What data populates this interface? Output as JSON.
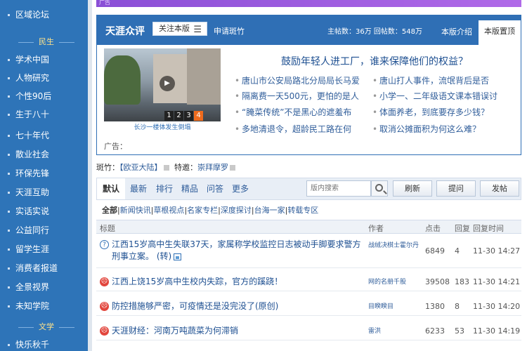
{
  "sidebar": {
    "top_item": "区域论坛",
    "section_minsheng": "民生",
    "minsheng_items": [
      "学术中国",
      "人物研究",
      "个性90后",
      "生于八十",
      "七十年代",
      "散业社会",
      "环保先锋",
      "天涯互助",
      "实话实说",
      "公益同行",
      "留学生涯",
      "消费者报道",
      "全景视界",
      "未知学院"
    ],
    "section_wenxue": "文学",
    "wenxue_items": [
      "快乐秋千"
    ]
  },
  "banner": {
    "ad_label": "广告"
  },
  "feature": {
    "logo": "天涯众评",
    "follow_label": "关注本版",
    "follow_icon": "menu-icon",
    "apply_label": "申请斑竹",
    "stats": "主帖数：36万  回帖数：548万",
    "tab_intro": "本版介绍",
    "tab_top": "本版置顶",
    "photo_caption": "长沙一楼体发生倒塌",
    "pager": [
      "1",
      "2",
      "3",
      "4"
    ],
    "headline": "鼓励年轻人进工厂，谁来保障他们的权益？",
    "news_left": [
      "唐山市公安局路北分局局长马爱",
      "隔离费一天500元，更怕的是人",
      "“腌菜传统”不是黑心的遮羞布",
      "多地清退令，超龄民工路在何"
    ],
    "news_right": [
      "唐山打人事件，流氓背后是否",
      "小学一、二年级语文课本错误讨",
      "体面养老，到底要存多少钱？",
      "取消公摊面积为何这么难？"
    ],
    "ad_label": "广告："
  },
  "board": {
    "moderator_label": "斑竹：",
    "moderator": "【欧亚大陆】",
    "special_label": "特邀：",
    "special": "崇拜摩罗"
  },
  "tabs": [
    "默认",
    "最新",
    "排行",
    "精品",
    "问答",
    "更多"
  ],
  "search": {
    "placeholder": "版内搜索"
  },
  "buttons": {
    "refresh": "刷新",
    "ask": "提问",
    "post": "发帖"
  },
  "categories": {
    "all": "全部",
    "items": [
      "新闻快讯",
      "草根视点",
      "名家专栏",
      "深度探讨",
      "台海一家",
      "转载专区"
    ]
  },
  "table": {
    "headers": {
      "title": "标题",
      "author": "作者",
      "clicks": "点击",
      "replies": "回复",
      "reply_time": "回复时间"
    },
    "rows": [
      {
        "icon": "question-icon",
        "title": "江西15岁高中生失联37天，家属称学校监控日志被动手脚要求警方刑事立案。",
        "suffix": "(转)",
        "author": "战绒决棋士霍尔丹",
        "clicks": "6849",
        "replies": "4",
        "time": "11-30 14:27"
      },
      {
        "icon": "hot-icon",
        "title": "江西上饶15岁高中生校内失踪，官方的蹊跷！",
        "suffix": "",
        "author": "网的名册千股",
        "clicks": "39508",
        "replies": "183",
        "time": "11-30 14:21"
      },
      {
        "icon": "hot-icon",
        "title": "防控措施够严密，可疫情还是没完没了(原创)",
        "suffix": "",
        "author": "目睽睽目",
        "clicks": "1380",
        "replies": "8",
        "time": "11-30 14:20"
      },
      {
        "icon": "hot-icon",
        "title": "天涯财经：河南万吨蔬菜为何滞销",
        "suffix": "",
        "author": "雷洪",
        "clicks": "6233",
        "replies": "53",
        "time": "11-30 14:19"
      }
    ]
  },
  "colors": {
    "sidebar": "#2e74b8",
    "header_blue": "#2f6fb5",
    "link": "#1d4f91",
    "accent_orange": "#ef6b1d",
    "hot_red": "#e2463d",
    "banner_purple": "#9b5de0"
  }
}
